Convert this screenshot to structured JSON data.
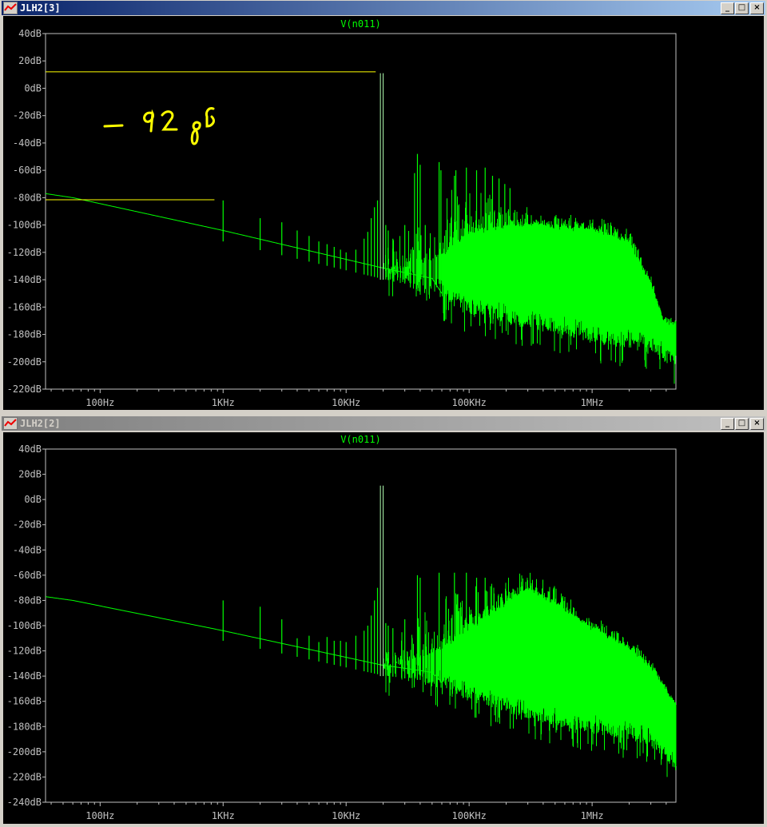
{
  "windows": [
    {
      "title": "JLH2[3]",
      "state": "active",
      "buttons": {
        "minimize": "_",
        "maximize": "□",
        "close": "×"
      }
    },
    {
      "title": "JLH2[2]",
      "state": "inactive",
      "buttons": {
        "minimize": "_",
        "maximize": "□",
        "close": "×"
      }
    }
  ],
  "colors": {
    "trace": "#00ff00",
    "axis": "#c0c0c0",
    "annotation": "#ffff00",
    "background": "#000000"
  },
  "chart_data": [
    {
      "type": "line",
      "title": "V(n011)",
      "xscale": "log",
      "xlim": [
        36,
        4800000
      ],
      "xticks": [
        {
          "f": 100,
          "label": "100Hz"
        },
        {
          "f": 1000,
          "label": "1KHz"
        },
        {
          "f": 10000,
          "label": "10KHz"
        },
        {
          "f": 100000,
          "label": "100KHz"
        },
        {
          "f": 1000000,
          "label": "1MHz"
        }
      ],
      "ylim": [
        -220,
        40
      ],
      "ystep": 20,
      "yunit": "dB",
      "noise_floor": [
        [
          36,
          -77
        ],
        [
          60,
          -80
        ],
        [
          1000,
          -104
        ],
        [
          19000,
          -131
        ],
        [
          50000,
          -139
        ],
        [
          60000,
          -150
        ]
      ],
      "tones": [
        [
          19000,
          11
        ],
        [
          20000,
          11
        ]
      ],
      "spurs": [
        [
          1000,
          -82
        ],
        [
          2000,
          -95
        ],
        [
          3000,
          -98
        ],
        [
          4000,
          -104
        ],
        [
          5000,
          -108
        ],
        [
          6000,
          -112
        ],
        [
          7000,
          -114
        ],
        [
          8000,
          -116
        ],
        [
          9000,
          -118
        ],
        [
          10000,
          -120
        ],
        [
          12000,
          -118
        ],
        [
          14000,
          -110
        ],
        [
          15000,
          -105
        ],
        [
          16000,
          -95
        ],
        [
          17000,
          -87
        ],
        [
          18000,
          -82
        ],
        [
          21000,
          -100
        ],
        [
          22000,
          -104
        ],
        [
          24000,
          -110
        ],
        [
          30000,
          -100
        ],
        [
          36000,
          -62
        ],
        [
          38000,
          -48
        ],
        [
          40000,
          -56
        ],
        [
          44000,
          -100
        ],
        [
          57000,
          -54
        ],
        [
          59000,
          -60
        ],
        [
          76000,
          -64
        ],
        [
          78000,
          -60
        ],
        [
          95000,
          -58
        ],
        [
          115000,
          -60
        ],
        [
          135000,
          -58
        ],
        [
          155000,
          -64
        ],
        [
          175000,
          -66
        ],
        [
          195000,
          -70
        ],
        [
          215000,
          -73
        ]
      ],
      "grass_upper": [
        [
          20000,
          -120
        ],
        [
          50000,
          -85
        ],
        [
          100000,
          -70
        ],
        [
          200000,
          -85
        ],
        [
          400000,
          -95
        ],
        [
          1000000,
          -95
        ],
        [
          2000000,
          -105
        ],
        [
          3000000,
          -140
        ],
        [
          3800000,
          -170
        ],
        [
          4800000,
          -172
        ]
      ],
      "grass_dense": [
        [
          20000,
          -135
        ],
        [
          60000,
          -125
        ],
        [
          100000,
          -108
        ],
        [
          300000,
          -102
        ],
        [
          1000000,
          -106
        ],
        [
          2000000,
          -115
        ],
        [
          3000000,
          -145
        ],
        [
          3800000,
          -172
        ],
        [
          4800000,
          -175
        ]
      ],
      "grass_lower": [
        [
          20000,
          -140
        ],
        [
          60000,
          -155
        ],
        [
          100000,
          -165
        ],
        [
          500000,
          -180
        ],
        [
          1000000,
          -185
        ],
        [
          3000000,
          -195
        ],
        [
          4800000,
          -205
        ]
      ],
      "annotations": {
        "lines": [
          {
            "from": [
              36,
              12
            ],
            "to": [
              17400,
              12
            ]
          },
          {
            "from": [
              36,
              -81.5
            ],
            "to": [
              850,
              -81.5
            ]
          }
        ],
        "handwriting": "-92 dB"
      }
    },
    {
      "type": "line",
      "title": "V(n011)",
      "xscale": "log",
      "xlim": [
        36,
        4800000
      ],
      "xticks": [
        {
          "f": 100,
          "label": "100Hz"
        },
        {
          "f": 1000,
          "label": "1KHz"
        },
        {
          "f": 10000,
          "label": "10KHz"
        },
        {
          "f": 100000,
          "label": "100KHz"
        },
        {
          "f": 1000000,
          "label": "1MHz"
        }
      ],
      "ylim": [
        -240,
        40
      ],
      "ystep": 20,
      "yunit": "dB",
      "noise_floor": [
        [
          36,
          -77
        ],
        [
          60,
          -80
        ],
        [
          1000,
          -104
        ],
        [
          19000,
          -131
        ],
        [
          50000,
          -137
        ],
        [
          60000,
          -145
        ]
      ],
      "tones": [
        [
          19000,
          11
        ],
        [
          20000,
          11
        ]
      ],
      "spurs": [
        [
          1000,
          -80
        ],
        [
          2000,
          -85
        ],
        [
          3000,
          -95
        ],
        [
          4000,
          -110
        ],
        [
          5000,
          -108
        ],
        [
          6000,
          -113
        ],
        [
          7000,
          -109
        ],
        [
          8000,
          -112
        ],
        [
          9000,
          -112
        ],
        [
          10000,
          -113
        ],
        [
          12000,
          -108
        ],
        [
          14000,
          -104
        ],
        [
          15000,
          -100
        ],
        [
          16000,
          -92
        ],
        [
          17000,
          -80
        ],
        [
          18000,
          -70
        ],
        [
          21000,
          -98
        ],
        [
          22000,
          -100
        ],
        [
          24000,
          -102
        ],
        [
          30000,
          -95
        ],
        [
          38000,
          -60
        ],
        [
          40000,
          -62
        ],
        [
          57000,
          -58
        ],
        [
          76000,
          -58
        ],
        [
          95000,
          -58
        ],
        [
          115000,
          -62
        ],
        [
          135000,
          -62
        ]
      ],
      "grass_upper": [
        [
          20000,
          -120
        ],
        [
          50000,
          -80
        ],
        [
          100000,
          -72
        ],
        [
          300000,
          -60
        ],
        [
          500000,
          -70
        ],
        [
          1000000,
          -95
        ],
        [
          2000000,
          -110
        ],
        [
          3000000,
          -130
        ],
        [
          4800000,
          -160
        ]
      ],
      "grass_dense": [
        [
          20000,
          -135
        ],
        [
          60000,
          -120
        ],
        [
          100000,
          -105
        ],
        [
          300000,
          -72
        ],
        [
          600000,
          -90
        ],
        [
          1000000,
          -105
        ],
        [
          2000000,
          -120
        ],
        [
          3000000,
          -135
        ],
        [
          4800000,
          -165
        ]
      ],
      "grass_lower": [
        [
          20000,
          -140
        ],
        [
          60000,
          -150
        ],
        [
          100000,
          -160
        ],
        [
          500000,
          -180
        ],
        [
          1000000,
          -185
        ],
        [
          3000000,
          -195
        ],
        [
          4800000,
          -215
        ]
      ],
      "annotations": null
    }
  ]
}
